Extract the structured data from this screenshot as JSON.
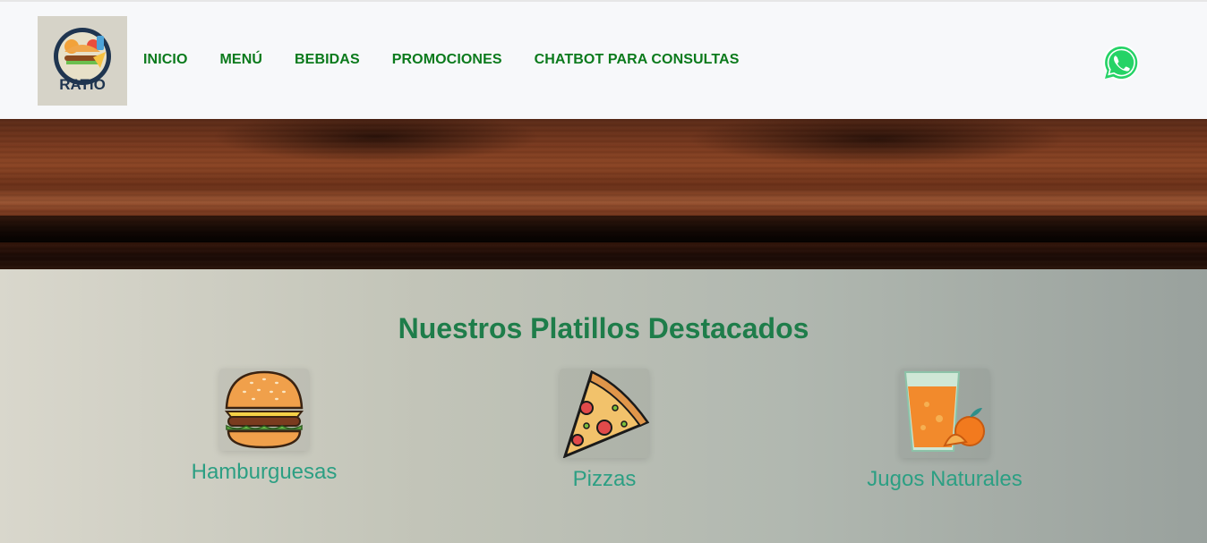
{
  "header": {
    "logo_text": "RATIO",
    "nav": [
      "INICIO",
      "MENÚ",
      "BEBIDAS",
      "PROMOCIONES",
      "CHATBOT PARA CONSULTAS"
    ],
    "whatsapp_icon": "whatsapp-icon"
  },
  "featured": {
    "title": "Nuestros Platillos Destacados",
    "items": [
      {
        "label": "Hamburguesas",
        "icon": "burger-icon"
      },
      {
        "label": "Pizzas",
        "icon": "pizza-icon"
      },
      {
        "label": "Jugos Naturales",
        "icon": "juice-icon"
      }
    ]
  },
  "colors": {
    "nav": "#0b7a1c",
    "title": "#1e7d4a",
    "card_label": "#2c9f83",
    "whatsapp": "#25d366"
  }
}
